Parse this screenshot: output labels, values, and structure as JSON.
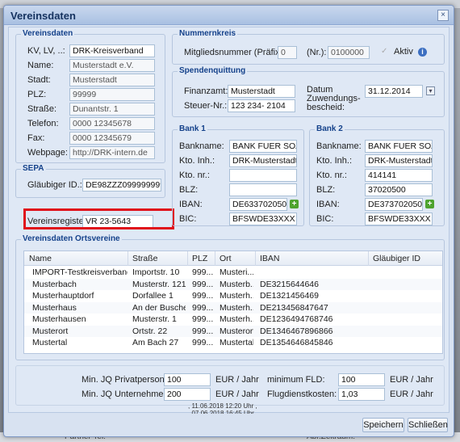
{
  "background": {
    "footer_left": "Partner Tel:",
    "footer_right": "Abr.Zeitraum:"
  },
  "dialog": {
    "title": "Vereinsdaten",
    "close_glyph": "×"
  },
  "vereinsdaten": {
    "legend": "Vereinsdaten",
    "fields": [
      {
        "label": "KV, LV, ..:",
        "value": "DRK-Kreisverband"
      },
      {
        "label": "Name:",
        "value": "Musterstadt e.V."
      },
      {
        "label": "Stadt:",
        "value": "Musterstadt"
      },
      {
        "label": "PLZ:",
        "value": "99999"
      },
      {
        "label": "Straße:",
        "value": "Dunantstr. 1"
      },
      {
        "label": "Telefon:",
        "value": "0000 12345678"
      },
      {
        "label": "Fax:",
        "value": "0000 12345679"
      },
      {
        "label": "Webpage:",
        "value": "http://DRK-intern.de"
      }
    ]
  },
  "sepa": {
    "legend": "SEPA",
    "glaeubiger_label": "Gläubiger ID.:",
    "glaeubiger_value": "DE98ZZZ099999999"
  },
  "vereinsregister": {
    "label": "Vereinsregister:",
    "value": "VR 23-5643"
  },
  "nummernkreis": {
    "legend": "Nummernkreis",
    "praefix_label": "Mitgliedsnummer (Präfix):",
    "praefix_value": "0",
    "nr_label": "(Nr.):",
    "nr_value": "0100000",
    "aktiv_label": "Aktiv",
    "check_glyph": "✓",
    "info_glyph": "i"
  },
  "spendenquittung": {
    "legend": "Spendenquittung",
    "finanzamt_label": "Finanzamt:",
    "finanzamt_value": "Musterstadt",
    "steuer_label": "Steuer-Nr.:",
    "steuer_value": "123 234- 2104",
    "datum_label_1": "Datum",
    "datum_label_2": "Zuwendungs-",
    "datum_label_3": "bescheid:",
    "datum_value": "31.12.2014",
    "calendar_glyph": "▾"
  },
  "bank1": {
    "legend": "Bank 1",
    "bankname_label": "Bankname:",
    "bankname_value": "BANK FUER SOZIAL",
    "ktoinh_label": "Kto. Inh.:",
    "ktoinh_value": "DRK-Musterstadt",
    "ktonr_label": "Kto. nr.:",
    "ktonr_value": "",
    "blz_label": "BLZ:",
    "blz_value": "",
    "iban_label": "IBAN:",
    "iban_value": "DE633702050000",
    "bic_label": "BIC:",
    "bic_value": "BFSWDE33XXX",
    "plus_glyph": "+"
  },
  "bank2": {
    "legend": "Bank 2",
    "bankname_label": "Bankname:",
    "bankname_value": "BANK FUER SOZIAL",
    "ktoinh_label": "Kto. Inh.:",
    "ktoinh_value": "DRK-Musterstadt",
    "ktonr_label": "Kto. nr.:",
    "ktonr_value": "414141",
    "blz_label": "BLZ:",
    "blz_value": "37020500",
    "iban_label": "IBAN:",
    "iban_value": "DE373702050000",
    "bic_label": "BIC:",
    "bic_value": "BFSWDE33XXX",
    "plus_glyph": "+"
  },
  "ortsvereine": {
    "legend": "Vereinsdaten Ortsvereine",
    "columns": [
      "Name",
      "Straße",
      "PLZ",
      "Ort",
      "IBAN",
      "Gläubiger ID"
    ],
    "rows": [
      [
        "IMPORT-Testkreisverband",
        "Importstr. 10",
        "999...",
        "Musteri...",
        "",
        ""
      ],
      [
        "Musterbach",
        "Musterstr. 121",
        "999...",
        "Musterb...",
        "DE3215644646",
        ""
      ],
      [
        "Musterhauptdorf",
        "Dorfallee 1",
        "999...",
        "Musterh...",
        "DE1321456469",
        ""
      ],
      [
        "Musterhaus",
        "An der Busche",
        "999...",
        "Musterh...",
        "DE213456847647",
        ""
      ],
      [
        "Musterhausen",
        "Musterstr. 1",
        "999...",
        "Musterh...",
        "DE1236494768746",
        ""
      ],
      [
        "Musterort",
        "Ortstr. 22",
        "999...",
        "Musterort",
        "DE1346467896866",
        ""
      ],
      [
        "Mustertal",
        "Am Bach 27",
        "999...",
        "Mustertal",
        "DE1354646845846",
        ""
      ]
    ]
  },
  "fees": {
    "privat_label": "Min. JQ Privatperson:",
    "privat_value": "100",
    "privat_unit": "EUR / Jahr",
    "unternehmen_label": "Min. JQ Unternehmen:",
    "unternehmen_value": "200",
    "unternehmen_unit": "EUR / Jahr",
    "fld_label": "minimum FLD:",
    "fld_value": "100",
    "fld_unit": "EUR / Jahr",
    "flug_label": "Flugdienstkosten:",
    "flug_value": "1,03",
    "flug_unit": "EUR / Jahr"
  },
  "stamps": {
    "line1": ", 11.06.2018 12:20 Uhr ,",
    "line2": ", 07.06.2018 16:45 Uhr"
  },
  "footer": {
    "save_label": "Speichern",
    "close_label": "Schließen"
  }
}
